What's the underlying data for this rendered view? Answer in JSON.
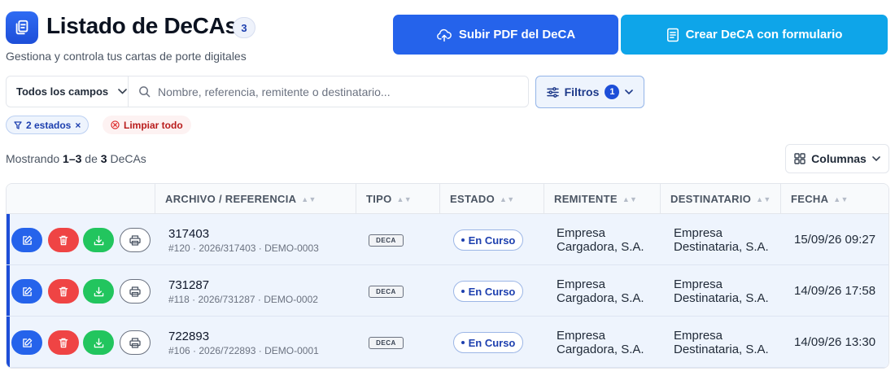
{
  "header": {
    "title": "Listado de DeCAs",
    "count": "3",
    "subtitle": "Gestiona y controla tus cartas de porte digitales",
    "upload_label": "Subir PDF del DeCA",
    "create_label": "Crear DeCA con formulario"
  },
  "search": {
    "field_select": "Todos los campos",
    "placeholder": "Nombre, referencia, remitente o destinatario...",
    "value": ""
  },
  "filters": {
    "label": "Filtros",
    "count": "1"
  },
  "chips": {
    "states": "2 estados",
    "clear": "Limpiar todo"
  },
  "summary": {
    "prefix": "Mostrando",
    "range": "1–3",
    "mid": "de",
    "total": "3",
    "suffix": "DeCAs"
  },
  "columns_button": "Columnas",
  "table": {
    "headers": {
      "archivo": "ARCHIVO / REFERENCIA",
      "tipo": "TIPO",
      "estado": "ESTADO",
      "remitente": "REMITENTE",
      "destinatario": "DESTINATARIO",
      "fecha": "FECHA"
    },
    "rows": [
      {
        "reference": "317403",
        "id": "#120",
        "code": "2026/317403",
        "demo": "DEMO-0003",
        "type": "DECA",
        "status": "En Curso",
        "sender_l1": "Empresa",
        "sender_l2": "Cargadora, S.A.",
        "recipient_l1": "Empresa",
        "recipient_l2": "Destinataria, S.A.",
        "date": "15/09/26 09:27"
      },
      {
        "reference": "731287",
        "id": "#118",
        "code": "2026/731287",
        "demo": "DEMO-0002",
        "type": "DECA",
        "status": "En Curso",
        "sender_l1": "Empresa",
        "sender_l2": "Cargadora, S.A.",
        "recipient_l1": "Empresa",
        "recipient_l2": "Destinataria, S.A.",
        "date": "14/09/26 17:58"
      },
      {
        "reference": "722893",
        "id": "#106",
        "code": "2026/722893",
        "demo": "DEMO-0001",
        "type": "DECA",
        "status": "En Curso",
        "sender_l1": "Empresa",
        "sender_l2": "Cargadora, S.A.",
        "recipient_l1": "Empresa",
        "recipient_l2": "Destinataria, S.A.",
        "date": "14/09/26 13:30"
      }
    ]
  },
  "colors": {
    "primary": "#2563eb",
    "sky": "#0ea5e9",
    "danger": "#ef4444",
    "success": "#22c55e",
    "row_bg": "#eef4fd"
  }
}
